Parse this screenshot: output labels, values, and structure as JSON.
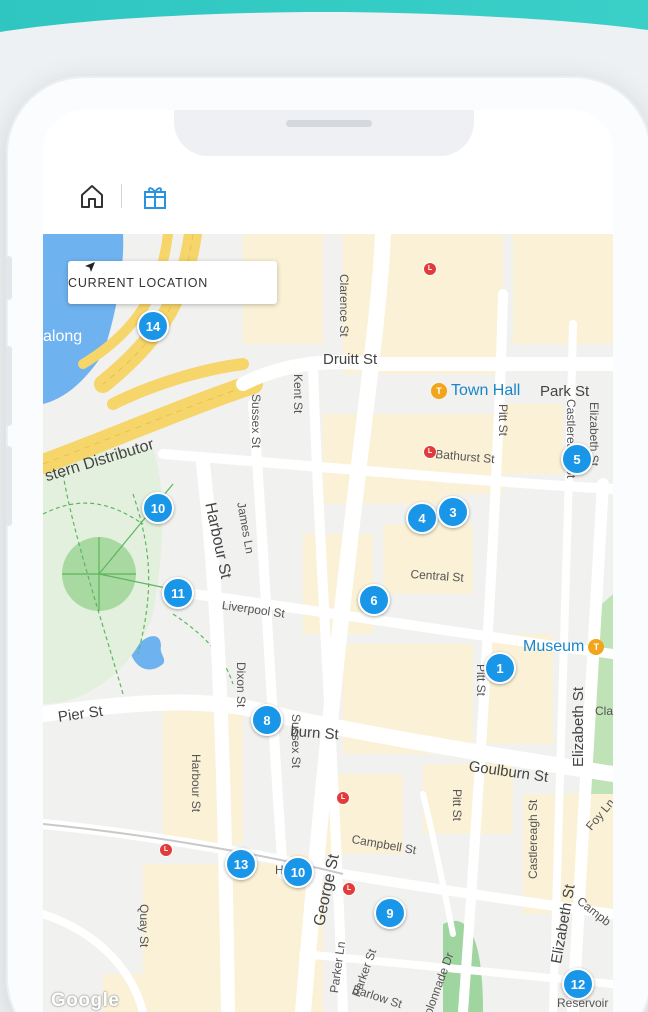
{
  "toolbar": {
    "home_icon": "home-icon",
    "gift_icon": "gift-icon"
  },
  "map": {
    "current_location_label": "CURRENT LOCATION",
    "attribution": "Google",
    "colors": {
      "marker": "#1a96e8",
      "rail": "#e23b3b",
      "park": "#c6e7c0",
      "water": "#6fb2f0",
      "highway": "#f6d56b",
      "block": "#faf1d6"
    },
    "markers": [
      "14",
      "5",
      "4",
      "3",
      "10",
      "11",
      "6",
      "1",
      "8",
      "13",
      "10",
      "9",
      "12"
    ],
    "streets": {
      "druitt": "Druitt St",
      "park": "Park St",
      "kent": "Kent St",
      "clarence": "Clarence St",
      "sussex": "Sussex St",
      "sussex2": "Sussex St",
      "pitt": "Pitt St",
      "pitt2": "Pitt St",
      "pitt3": "Pitt St",
      "castlereagh": "Castlereagh St",
      "castlereagh2": "Castlereagh St",
      "elizabeth": "Elizabeth St",
      "elizabeth2": "Elizabeth St",
      "elizabeth3": "Elizabeth St",
      "bathurst": "Bathurst St",
      "james": "James Ln",
      "harbour": "Harbour St",
      "harbour2": "Harbour St",
      "central": "Central St",
      "liverpool": "Liverpool St",
      "dixon": "Dixon St",
      "pier": "Pier St",
      "goulburn": "Goulburn St",
      "goulburn_partial": "burn St",
      "goulburn_c": "G",
      "campbell": "Campbell St",
      "campbell2": "Campb",
      "george": "George St",
      "parker_ln": "Parker Ln",
      "parker": "Parker St",
      "barlow": "Barlow St",
      "colonnade": "olonnade Dr",
      "quay": "Quay St",
      "foy": "Foy Ln",
      "cla": "Cla",
      "reservoir": "Reservoir",
      "distributor": "stern Distributor",
      "darling": "along",
      "dr": "Dr",
      "h": "H"
    },
    "pois": {
      "town_hall": "Town Hall",
      "museum": "Museum"
    },
    "poi_symbol": "T"
  }
}
